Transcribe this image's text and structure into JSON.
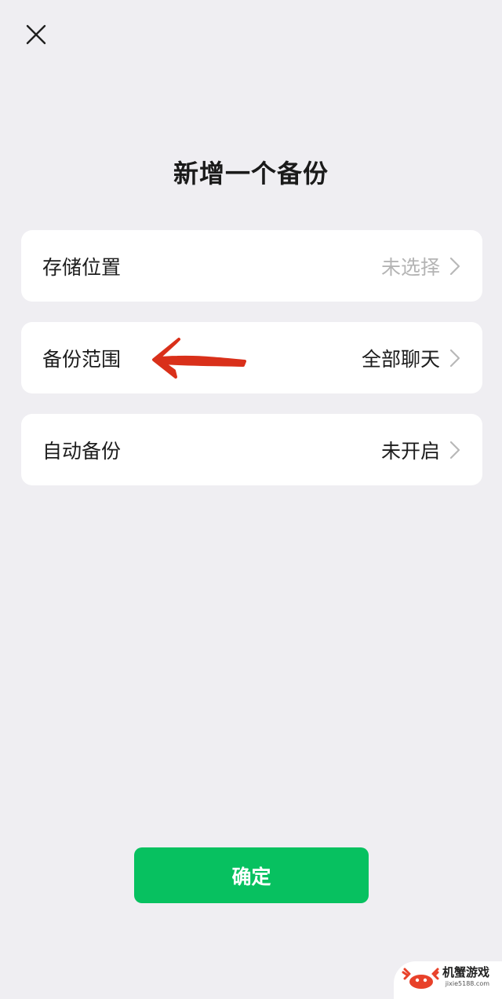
{
  "header": {
    "close_icon": "close-icon",
    "title": "新增一个备份"
  },
  "settings": [
    {
      "label": "存储位置",
      "value": "未选择",
      "muted": true
    },
    {
      "label": "备份范围",
      "value": "全部聊天",
      "muted": false
    },
    {
      "label": "自动备份",
      "value": "未开启",
      "muted": false
    }
  ],
  "annotation": {
    "icon": "red-arrow-icon",
    "color": "#d9301a"
  },
  "confirm_button": {
    "label": "确定",
    "color": "#07c160"
  },
  "watermark": {
    "name": "机蟹游戏",
    "url": "jixie5188.com",
    "accent_color": "#e8412a"
  }
}
